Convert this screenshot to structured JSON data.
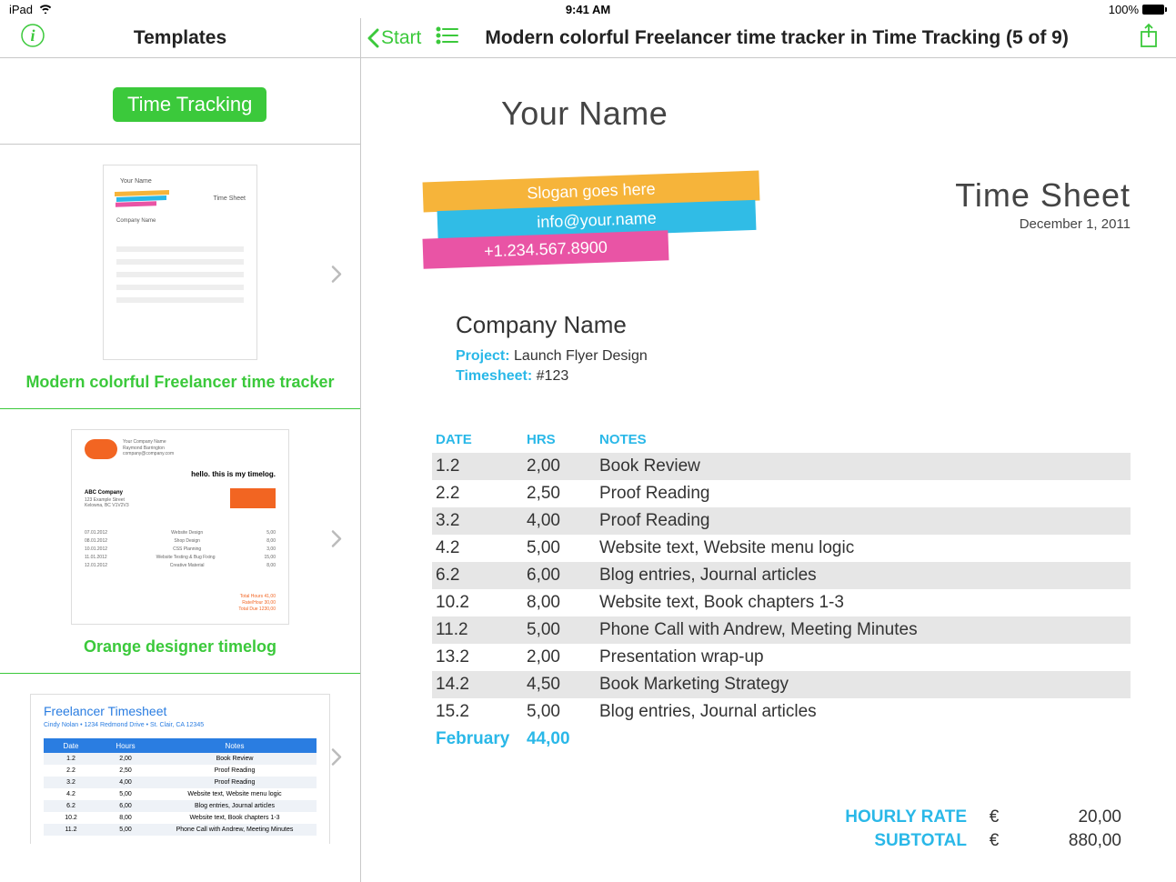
{
  "statusBar": {
    "device": "iPad",
    "time": "9:41 AM",
    "battery": "100%"
  },
  "nav": {
    "leftTitle": "Templates",
    "backLabel": "Start",
    "docTitle": "Modern colorful Freelancer time tracker in Time Tracking (5 of 9)"
  },
  "sidebar": {
    "categoryBadge": "Time Tracking",
    "templates": [
      {
        "label": "Modern colorful Freelancer time tracker"
      },
      {
        "label": "Orange designer timelog"
      },
      {
        "label": ""
      }
    ],
    "thumb1": {
      "name": "Your Name",
      "timesheet": "Time Sheet",
      "company": "Company Name"
    },
    "thumb2": {
      "logoText": "logo",
      "companyLines": "Your Company Name\nRaymond Barrington\ncompany@company.com",
      "hello": "hello. this is my timelog.",
      "abc": "ABC Company",
      "addr": "123 Example Street\nKelowna, BC V1V2V3"
    },
    "thumb3": {
      "title": "Freelancer Timesheet",
      "sub": "Cindy Nolan • 1234 Redmond Drive • St. Clair, CA 12345",
      "headDate": "Date",
      "headHours": "Hours",
      "headNotes": "Notes",
      "rows": [
        {
          "d": "1.2",
          "h": "2,00",
          "n": "Book Review"
        },
        {
          "d": "2.2",
          "h": "2,50",
          "n": "Proof Reading"
        },
        {
          "d": "3.2",
          "h": "4,00",
          "n": "Proof Reading"
        },
        {
          "d": "4.2",
          "h": "5,00",
          "n": "Website text, Website menu logic"
        },
        {
          "d": "6.2",
          "h": "6,00",
          "n": "Blog entries, Journal articles"
        },
        {
          "d": "10.2",
          "h": "8,00",
          "n": "Website text, Book chapters 1-3"
        },
        {
          "d": "11.2",
          "h": "5,00",
          "n": "Phone Call with Andrew, Meeting Minutes"
        }
      ]
    }
  },
  "doc": {
    "yourName": "Your Name",
    "sloganOrange": "Slogan goes here",
    "sloganBlue": "info@your.name",
    "sloganPink": "+1.234.567.8900",
    "timesheetTitle": "Time Sheet",
    "timesheetDate": "December 1, 2011",
    "companyName": "Company Name",
    "projectLabel": "Project:",
    "projectValue": "Launch Flyer Design",
    "timesheetLabel": "Timesheet:",
    "timesheetNum": "#123",
    "headers": {
      "date": "DATE",
      "hrs": "HRS",
      "notes": "NOTES"
    },
    "rows": [
      {
        "date": "1.2",
        "hrs": "2,00",
        "notes": "Book Review"
      },
      {
        "date": "2.2",
        "hrs": "2,50",
        "notes": "Proof Reading"
      },
      {
        "date": "3.2",
        "hrs": "4,00",
        "notes": "Proof Reading"
      },
      {
        "date": "4.2",
        "hrs": "5,00",
        "notes": "Website text, Website menu logic"
      },
      {
        "date": "6.2",
        "hrs": "6,00",
        "notes": "Blog entries, Journal articles"
      },
      {
        "date": "10.2",
        "hrs": "8,00",
        "notes": "Website text, Book chapters 1-3"
      },
      {
        "date": "11.2",
        "hrs": "5,00",
        "notes": "Phone Call with Andrew, Meeting Minutes"
      },
      {
        "date": "13.2",
        "hrs": "2,00",
        "notes": "Presentation wrap-up"
      },
      {
        "date": "14.2",
        "hrs": "4,50",
        "notes": "Book Marketing Strategy"
      },
      {
        "date": "15.2",
        "hrs": "5,00",
        "notes": "Blog entries, Journal articles"
      }
    ],
    "totalRow": {
      "month": "February",
      "hrs": "44,00"
    },
    "hourlyRateLabel": "HOURLY RATE",
    "subtotalLabel": "SUBTOTAL",
    "currency": "€",
    "hourlyRate": "20,00",
    "subtotal": "880,00"
  }
}
